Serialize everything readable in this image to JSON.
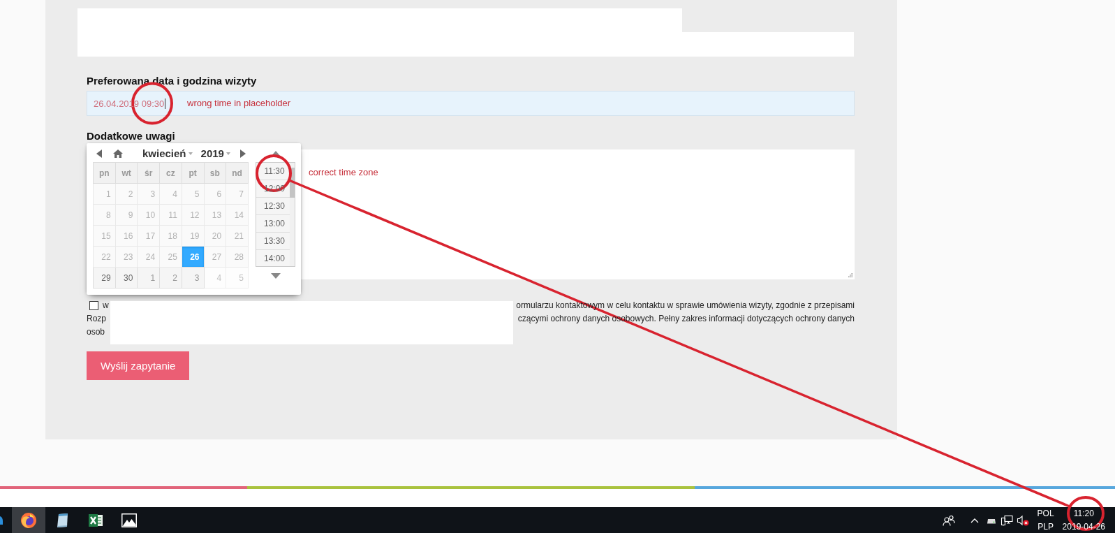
{
  "form": {
    "date_field": {
      "label": "Preferowana data i godzina wizyty",
      "value": "26.04.2019 09:30"
    },
    "notes_field": {
      "label": "Dodatkowe uwagi"
    },
    "consent": {
      "checked": false,
      "lines": [
        {
          "start": "w",
          "end": "ormularzu kontaktowym w celu kontaktu w sprawie umówienia wizyty, zgodnie z przepisami"
        },
        {
          "start": "Rozp",
          "end": "czącymi ochrony danych osobowych. Pełny zakres informacji dotyczących ochrony danych"
        },
        {
          "start": "osob"
        }
      ]
    },
    "submit_button": "Wyślij zapytanie"
  },
  "datepicker": {
    "month": "kwiecień",
    "year": "2019",
    "weekdays": [
      "pn",
      "wt",
      "śr",
      "cz",
      "pt",
      "sb",
      "nd"
    ],
    "weeks": [
      [
        {
          "label": "1",
          "selected": false,
          "disabled": true,
          "other_month": false
        },
        {
          "label": "2",
          "selected": false,
          "disabled": true,
          "other_month": false
        },
        {
          "label": "3",
          "selected": false,
          "disabled": true,
          "other_month": false
        },
        {
          "label": "4",
          "selected": false,
          "disabled": true,
          "other_month": false
        },
        {
          "label": "5",
          "selected": false,
          "disabled": true,
          "other_month": false
        },
        {
          "label": "6",
          "selected": false,
          "disabled": true,
          "other_month": false
        },
        {
          "label": "7",
          "selected": false,
          "disabled": true,
          "other_month": false
        }
      ],
      [
        {
          "label": "8",
          "selected": false,
          "disabled": true,
          "other_month": false
        },
        {
          "label": "9",
          "selected": false,
          "disabled": true,
          "other_month": false
        },
        {
          "label": "10",
          "selected": false,
          "disabled": true,
          "other_month": false
        },
        {
          "label": "11",
          "selected": false,
          "disabled": true,
          "other_month": false
        },
        {
          "label": "12",
          "selected": false,
          "disabled": true,
          "other_month": false
        },
        {
          "label": "13",
          "selected": false,
          "disabled": true,
          "other_month": false
        },
        {
          "label": "14",
          "selected": false,
          "disabled": true,
          "other_month": false
        }
      ],
      [
        {
          "label": "15",
          "selected": false,
          "disabled": true,
          "other_month": false
        },
        {
          "label": "16",
          "selected": false,
          "disabled": true,
          "other_month": false
        },
        {
          "label": "17",
          "selected": false,
          "disabled": true,
          "other_month": false
        },
        {
          "label": "18",
          "selected": false,
          "disabled": true,
          "other_month": false
        },
        {
          "label": "19",
          "selected": false,
          "disabled": true,
          "other_month": false
        },
        {
          "label": "20",
          "selected": false,
          "disabled": true,
          "other_month": false
        },
        {
          "label": "21",
          "selected": false,
          "disabled": true,
          "other_month": false
        }
      ],
      [
        {
          "label": "22",
          "selected": false,
          "disabled": true,
          "other_month": false
        },
        {
          "label": "23",
          "selected": false,
          "disabled": true,
          "other_month": false
        },
        {
          "label": "24",
          "selected": false,
          "disabled": true,
          "other_month": false
        },
        {
          "label": "25",
          "selected": false,
          "disabled": true,
          "other_month": false
        },
        {
          "label": "26",
          "selected": true,
          "disabled": false,
          "other_month": false
        },
        {
          "label": "27",
          "selected": false,
          "disabled": true,
          "other_month": false
        },
        {
          "label": "28",
          "selected": false,
          "disabled": true,
          "other_month": false
        }
      ],
      [
        {
          "label": "29",
          "selected": false,
          "disabled": false,
          "other_month": false
        },
        {
          "label": "30",
          "selected": false,
          "disabled": false,
          "other_month": false
        },
        {
          "label": "1",
          "selected": false,
          "disabled": false,
          "other_month": true
        },
        {
          "label": "2",
          "selected": false,
          "disabled": false,
          "other_month": true
        },
        {
          "label": "3",
          "selected": false,
          "disabled": false,
          "other_month": true
        },
        {
          "label": "4",
          "selected": false,
          "disabled": true,
          "other_month": true
        },
        {
          "label": "5",
          "selected": false,
          "disabled": true,
          "other_month": true
        }
      ]
    ],
    "times": [
      {
        "label": "11:30",
        "selected": false
      },
      {
        "label": "12:00",
        "selected": false
      },
      {
        "label": "12:30",
        "selected": false
      },
      {
        "label": "13:00",
        "selected": false
      },
      {
        "label": "13:30",
        "selected": false
      },
      {
        "label": "14:00",
        "selected": false
      }
    ]
  },
  "annotations": [
    {
      "text": "wrong time in placeholder"
    },
    {
      "text": "correct time zone"
    }
  ],
  "taskbar": {
    "apps": [
      {
        "kind": "browser",
        "active": true
      },
      {
        "kind": "notepad",
        "active": false
      },
      {
        "kind": "spreadsheet",
        "active": false
      },
      {
        "kind": "photos",
        "active": false
      }
    ],
    "input_language": [
      "POL",
      "PLP"
    ],
    "clock": {
      "time": "11:20",
      "date": "2019-04-26"
    }
  }
}
